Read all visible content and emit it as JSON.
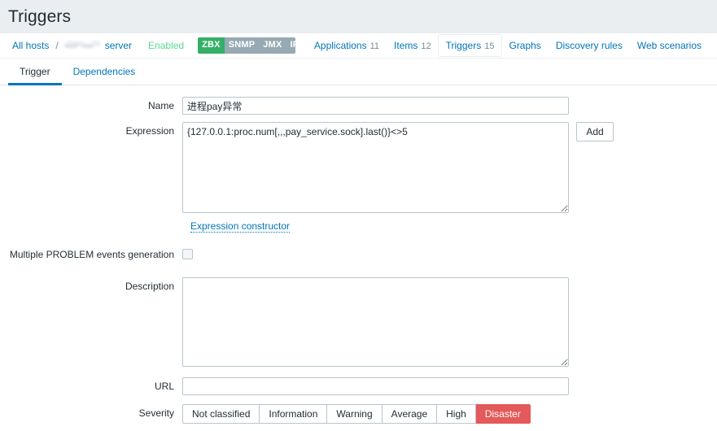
{
  "header": {
    "title": "Triggers"
  },
  "breadcrumb": {
    "all_hosts_label": "All hosts",
    "separator": "/",
    "host_name": "",
    "host_suffix": "server",
    "status_label": "Enabled",
    "interfaces": [
      {
        "label": "ZBX",
        "active": true
      },
      {
        "label": "SNMP",
        "active": false
      },
      {
        "label": "JMX",
        "active": false
      },
      {
        "label": "IPMI",
        "active": false
      }
    ],
    "nav_tabs": [
      {
        "label": "Applications",
        "count": "11",
        "selected": false
      },
      {
        "label": "Items",
        "count": "12",
        "selected": false
      },
      {
        "label": "Triggers",
        "count": "15",
        "selected": true
      },
      {
        "label": "Graphs",
        "count": "",
        "selected": false
      },
      {
        "label": "Discovery rules",
        "count": "",
        "selected": false
      },
      {
        "label": "Web scenarios",
        "count": "",
        "selected": false
      }
    ]
  },
  "form_tabs": [
    {
      "label": "Trigger",
      "active": true
    },
    {
      "label": "Dependencies",
      "active": false
    }
  ],
  "form": {
    "name": {
      "label": "Name",
      "value": "进程pay异常",
      "placeholder": ""
    },
    "expression": {
      "label": "Expression",
      "value": "{127.0.0.1:proc.num[,,,pay_service.sock].last()}<>5",
      "placeholder": "",
      "add_button_label": "Add",
      "constructor_link_label": "Expression constructor"
    },
    "multiple_problem_events": {
      "label": "Multiple PROBLEM events generation",
      "checked": false
    },
    "description": {
      "label": "Description",
      "value": "",
      "placeholder": ""
    },
    "url": {
      "label": "URL",
      "value": "",
      "placeholder": ""
    },
    "severity": {
      "label": "Severity",
      "options": [
        {
          "label": "Not classified",
          "selected": false
        },
        {
          "label": "Information",
          "selected": false
        },
        {
          "label": "Warning",
          "selected": false
        },
        {
          "label": "Average",
          "selected": false
        },
        {
          "label": "High",
          "selected": false
        },
        {
          "label": "Disaster",
          "selected": true
        }
      ],
      "selected_value": "Disaster"
    }
  },
  "colors": {
    "accent_link": "#0275b8",
    "header_bg": "#ebeef0",
    "status_enabled": "#59db8f",
    "interface_active": "#34af67",
    "interface_inactive": "#97aab3",
    "severity_disaster": "#e45959"
  }
}
